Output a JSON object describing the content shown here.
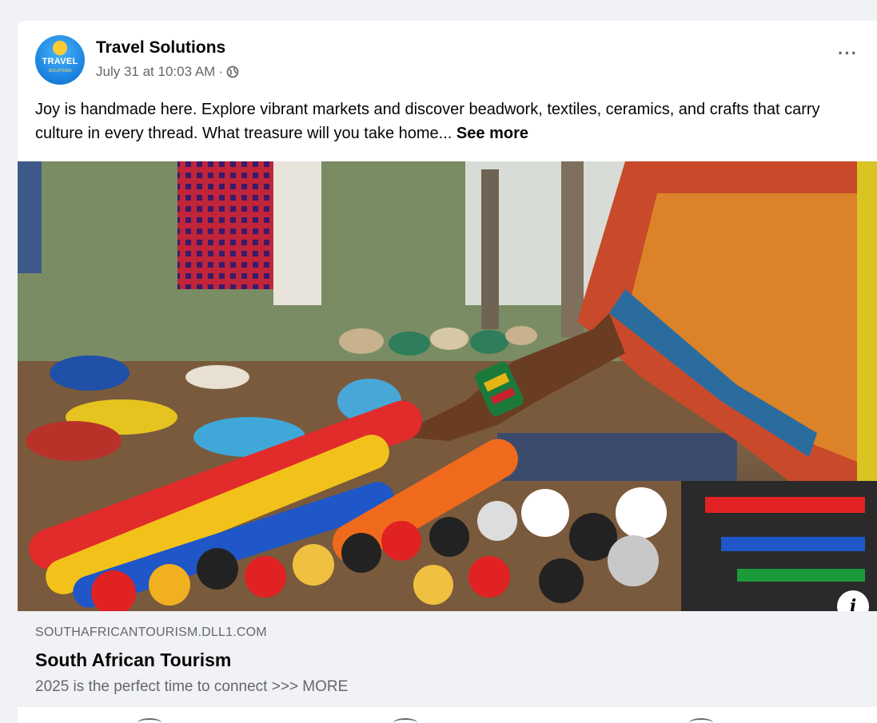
{
  "post": {
    "author": "Travel Solutions",
    "timestamp": "July 31 at 10:03 AM",
    "separator": "·",
    "privacy_icon": "globe-icon",
    "more_icon": "more-options-icon",
    "more_label": "···",
    "caption": "Joy is handmade here. Explore vibrant markets and discover beadwork, textiles, ceramics, and crafts that carry culture in every thread. What treasure will you take home...",
    "see_more": "See more",
    "avatar": {
      "text": "TRAVEL",
      "subtext": "SOLUTIONS"
    }
  },
  "image": {
    "description_icon": "info-icon",
    "info_label": "i"
  },
  "link_preview": {
    "domain": "SOUTHAFRICANTOURISM.DLL1.COM",
    "title": "South African Tourism",
    "description": "2025 is the perfect time to connect >>> MORE"
  },
  "colors": {
    "background": "#f0f2f5",
    "card": "#ffffff",
    "primary_text": "#050505",
    "secondary_text": "#65676b"
  }
}
